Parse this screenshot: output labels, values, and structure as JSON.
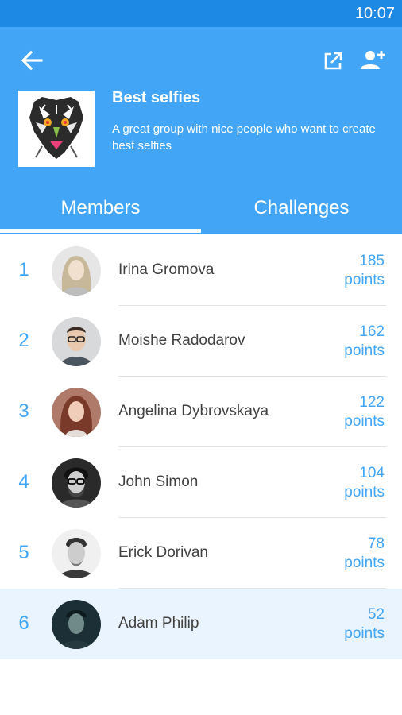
{
  "status": {
    "time": "10:07"
  },
  "group": {
    "title": "Best selfies",
    "description": "A great group with nice people who want to create best selfies"
  },
  "tabs": [
    {
      "label": "Members",
      "active": true
    },
    {
      "label": "Challenges",
      "active": false
    }
  ],
  "points_unit": "points",
  "members": [
    {
      "rank": "1",
      "name": "Irina Gromova",
      "points": "185"
    },
    {
      "rank": "2",
      "name": "Moishe Radodarov",
      "points": "162"
    },
    {
      "rank": "3",
      "name": "Angelina Dybrovskaya",
      "points": "122"
    },
    {
      "rank": "4",
      "name": "John Simon",
      "points": "104"
    },
    {
      "rank": "5",
      "name": "Erick  Dorivan",
      "points": "78"
    },
    {
      "rank": "6",
      "name": "Adam Philip",
      "points": "52"
    }
  ],
  "colors": {
    "accent": "#42a5f5",
    "status_bar": "#1e88e5",
    "highlight_row": "#eaf4fe"
  },
  "icons": {
    "back": "arrow-left-icon",
    "share": "open-external-icon",
    "add_member": "add-person-icon"
  }
}
